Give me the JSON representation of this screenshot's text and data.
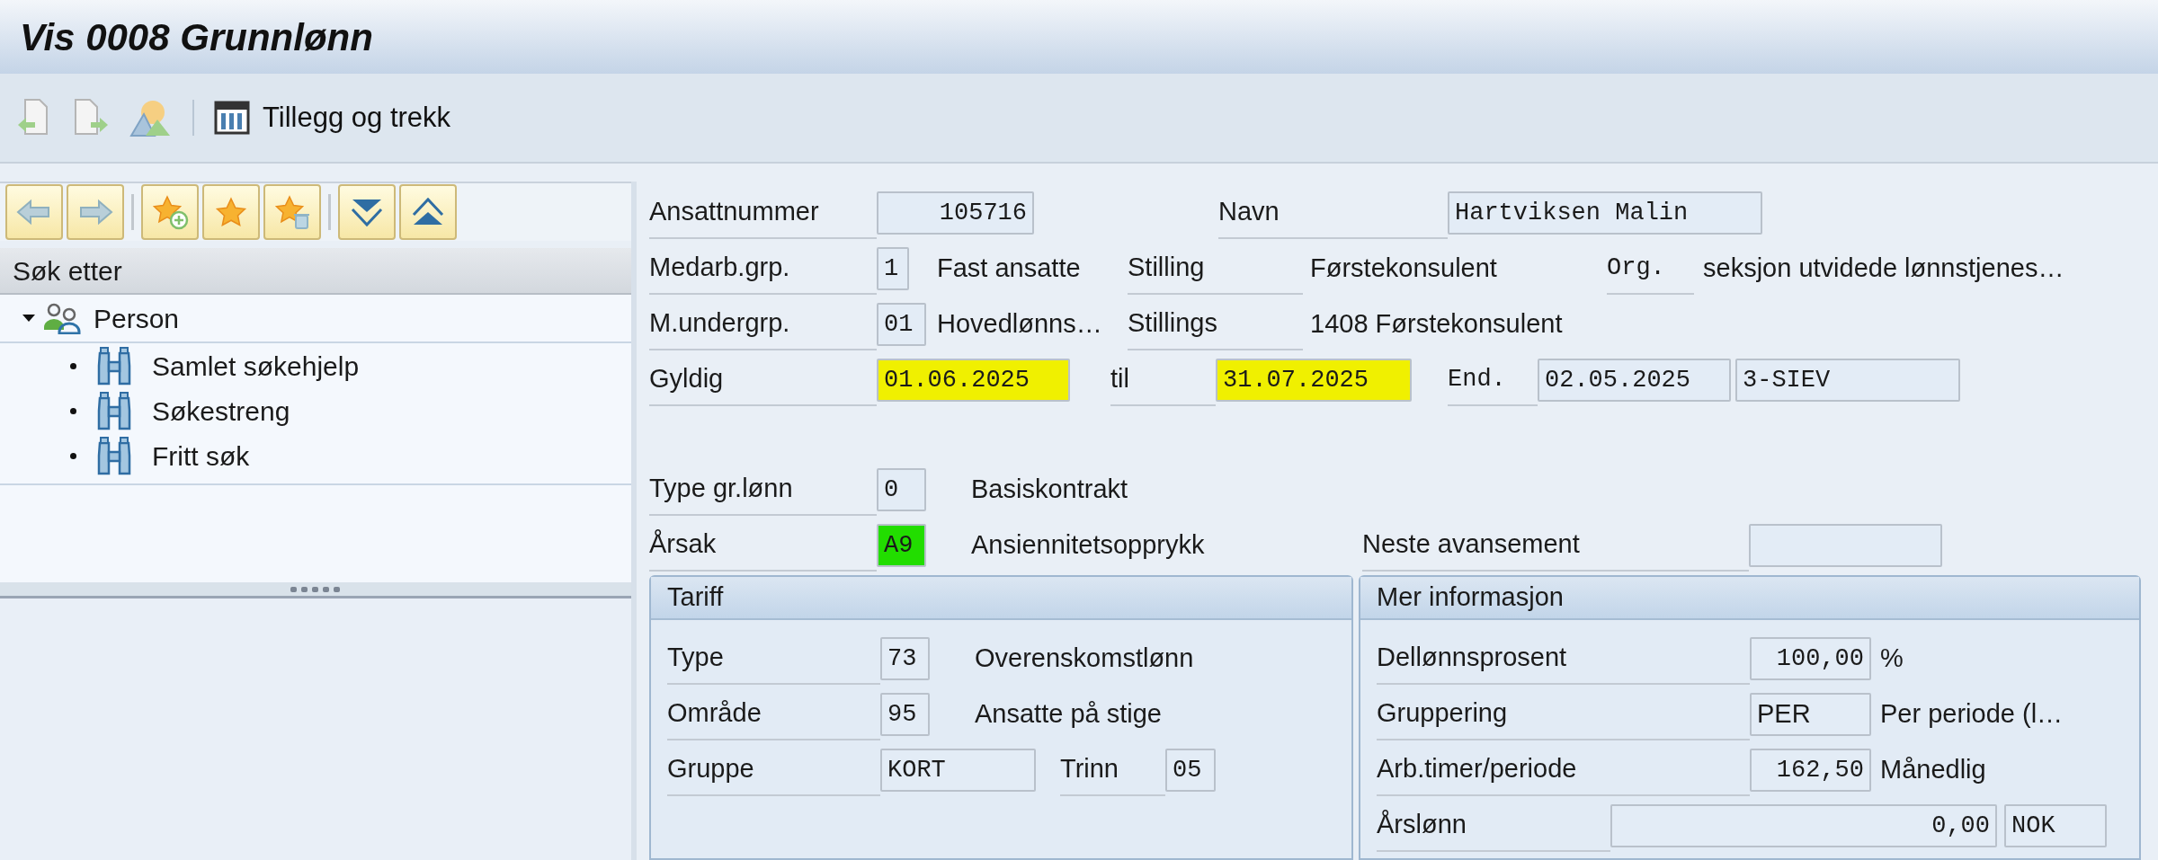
{
  "window": {
    "title": "Vis 0008 Grunnlønn"
  },
  "toolbar": {
    "action": "Tillegg og trekk"
  },
  "navigator": {
    "header": "Søk etter",
    "tree": [
      {
        "label": "Person",
        "expanded": true,
        "children": [
          {
            "label": "Samlet søkehjelp"
          },
          {
            "label": "Søkestreng"
          },
          {
            "label": "Fritt søk"
          }
        ]
      }
    ]
  },
  "header": {
    "employee_number": {
      "label": "Ansattnummer",
      "value": "105716"
    },
    "name": {
      "label": "Navn",
      "value": "Hartviksen Malin"
    },
    "employee_group": {
      "label": "Medarb.grp.",
      "value": "1",
      "text": "Fast ansatte"
    },
    "position": {
      "label": "Stilling",
      "text": "Førstekonsulent"
    },
    "org_unit": {
      "label": "Org.",
      "text": "seksjon utvidede lønnstjenes…"
    },
    "employee_subgroup": {
      "label": "M.undergrp.",
      "value": "01",
      "text": "Hovedlønns…"
    },
    "job": {
      "label": "Stillings",
      "text": "1408 Førstekonsulent"
    },
    "valid_from": {
      "label": "Gyldig",
      "value": "01.06.2025",
      "color": "#f0f000"
    },
    "valid_to": {
      "label": "til",
      "value": "31.07.2025",
      "color": "#f0f000"
    },
    "changed": {
      "label": "End.",
      "date": "02.05.2025",
      "user": "3-SIEV"
    }
  },
  "basic_pay": {
    "pay_type": {
      "label": "Type gr.lønn",
      "value": "0",
      "text": "Basiskontrakt"
    },
    "reason": {
      "label": "Årsak",
      "value": "A9",
      "text": "Ansiennitetsopprykk",
      "color": "#22dd00"
    },
    "next_increase": {
      "label": "Neste avansement"
    }
  },
  "tariff": {
    "title": "Tariff",
    "type": {
      "label": "Type",
      "value": "73",
      "text": "Overenskomstlønn"
    },
    "area": {
      "label": "Område",
      "value": "95",
      "text": "Ansatte på stige"
    },
    "group": {
      "label": "Gruppe",
      "value": "KORT"
    },
    "level": {
      "label": "Trinn",
      "value": "05"
    }
  },
  "more_info": {
    "title": "Mer informasjon",
    "part_time": {
      "label": "Dellønnsprosent",
      "value": "100,00",
      "unit": "%"
    },
    "grouping": {
      "label": "Gruppering",
      "value": "PER",
      "text": "Per periode (l…"
    },
    "hours": {
      "label": "Arb.timer/periode",
      "value": "162,50",
      "text": "Månedlig"
    },
    "annual_salary": {
      "label": "Årslønn",
      "value": "0,00",
      "currency": "NOK"
    }
  }
}
